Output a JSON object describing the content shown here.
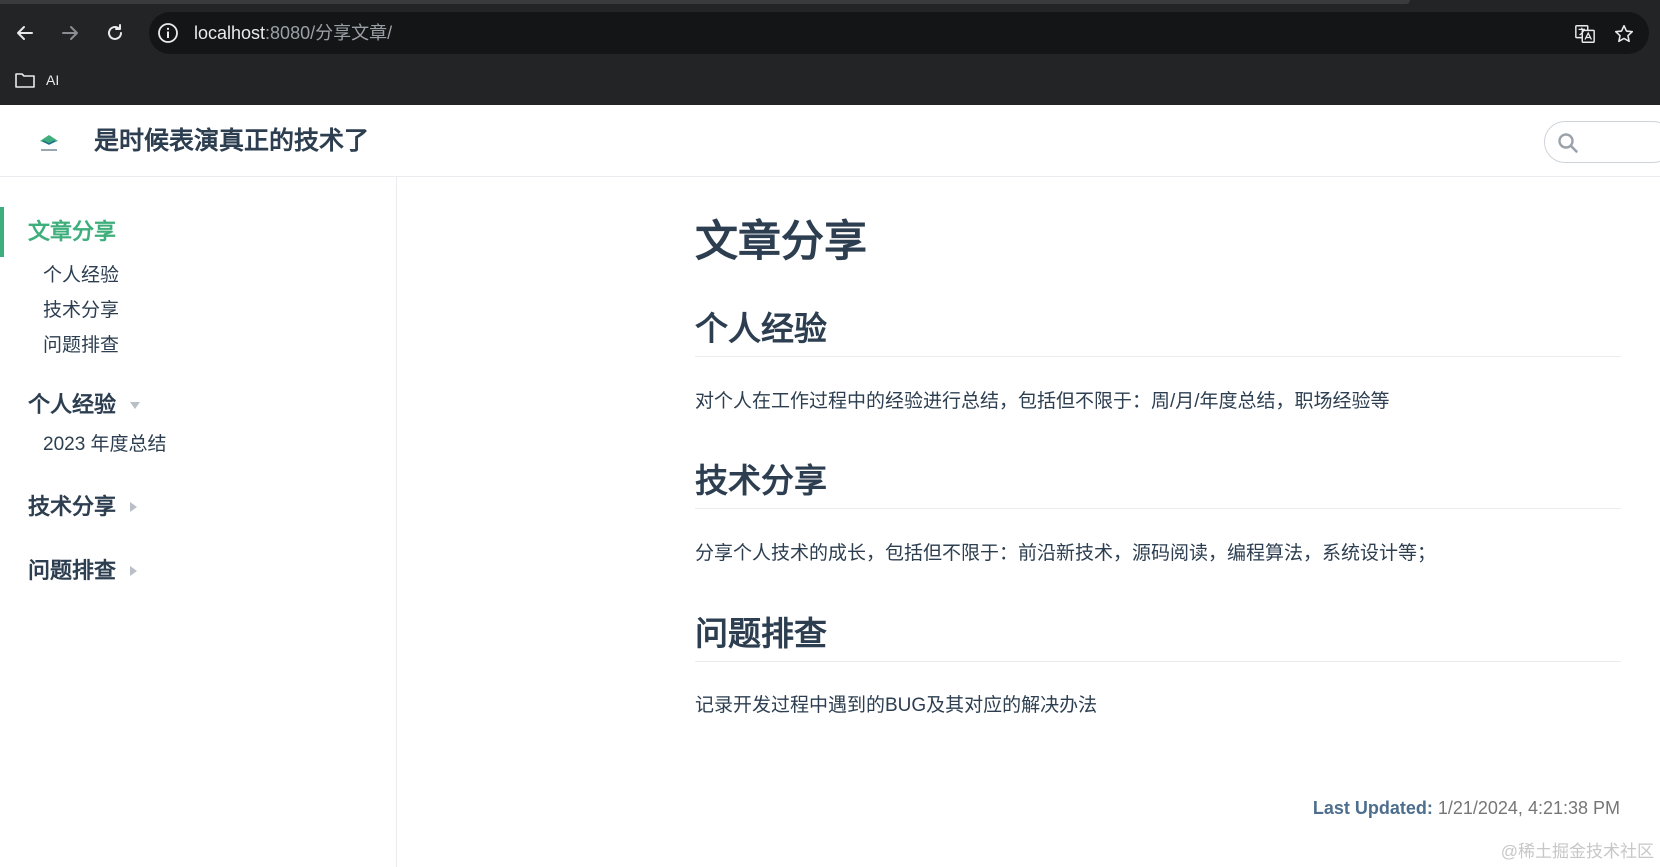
{
  "browser": {
    "url_host": "localhost",
    "url_path": ":8080/分享文章/",
    "bookmarks": [
      {
        "label": "AI"
      }
    ]
  },
  "site": {
    "title": "是时候表演真正的技术了"
  },
  "sidebar": {
    "active_label": "文章分享",
    "sub_items": [
      {
        "label": "个人经验"
      },
      {
        "label": "技术分享"
      },
      {
        "label": "问题排查"
      }
    ],
    "groups": [
      {
        "label": "个人经验",
        "expanded": true,
        "children": [
          {
            "label": "2023 年度总结"
          }
        ]
      },
      {
        "label": "技术分享",
        "expanded": false
      },
      {
        "label": "问题排查",
        "expanded": false
      }
    ]
  },
  "content": {
    "title": "文章分享",
    "sections": [
      {
        "heading": "个人经验",
        "text": "对个人在工作过程中的经验进行总结，包括但不限于：周/月/年度总结，职场经验等"
      },
      {
        "heading": "技术分享",
        "text": "分享个人技术的成长，包括但不限于：前沿新技术，源码阅读，编程算法，系统设计等；"
      },
      {
        "heading": "问题排查",
        "text": "记录开发过程中遇到的BUG及其对应的解决办法"
      }
    ],
    "last_updated_label": "Last Updated:",
    "last_updated_value": "1/21/2024, 4:21:38 PM",
    "watermark": "@稀土掘金技术社区"
  },
  "colors": {
    "accent": "#3eaf7c",
    "text": "#2c3e50",
    "chrome_bg": "#232426"
  }
}
